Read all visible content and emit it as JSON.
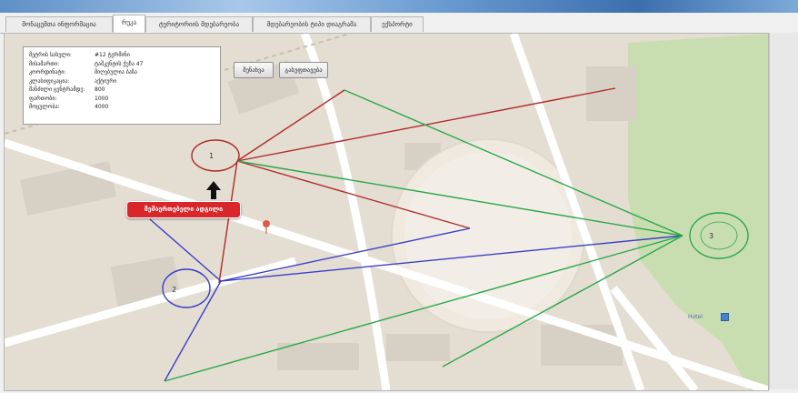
{
  "window": {
    "title": ""
  },
  "tabs": [
    {
      "label": "მონაცემთა ინფორმაცია",
      "active": false
    },
    {
      "label": "რუკა",
      "active": true
    },
    {
      "label": "ტერიტორიის მდებარეობა",
      "active": false
    },
    {
      "label": "მდებარეობის ტიპი დიაგრამა",
      "active": false
    },
    {
      "label": "ექსპორტი",
      "active": false
    }
  ],
  "info_panel": {
    "rows": [
      {
        "key": "მეტრის სახელი:",
        "value": "#12 ტერმინი"
      },
      {
        "key": "მისამართი:",
        "value": "ტაშკენტის ქუჩა 47"
      },
      {
        "key": "კოორდინატი:",
        "value": "მიღებულია ბაზა"
      },
      {
        "key": "კლასიფიკაცია:",
        "value": "აქტიური"
      },
      {
        "key": "მანძილი ცენტრამდე:",
        "value": "800"
      },
      {
        "key": "ფართობი:",
        "value": "1000"
      },
      {
        "key": "მოცულობა:",
        "value": "4000"
      }
    ]
  },
  "buttons": {
    "button1": "შენახვა",
    "button2": "გასუფთავება"
  },
  "tooltip": {
    "text": "შემაერთებელი ადგილი"
  },
  "nodes": [
    {
      "label": "1"
    },
    {
      "label": "2"
    },
    {
      "label": "3"
    }
  ],
  "map": {
    "poi_label": "Hotel"
  },
  "colors": {
    "cluster1": "#b02a2a",
    "cluster2": "#3a3fc8",
    "cluster3": "#2aa84a",
    "tooltip_bg": "#d9262b",
    "map_bg": "#e4ddd2",
    "park": "#c9deb0"
  },
  "icons": {
    "arrow": "arrow-up-icon",
    "marker": "map-pin-icon",
    "hotel": "hotel-icon"
  }
}
